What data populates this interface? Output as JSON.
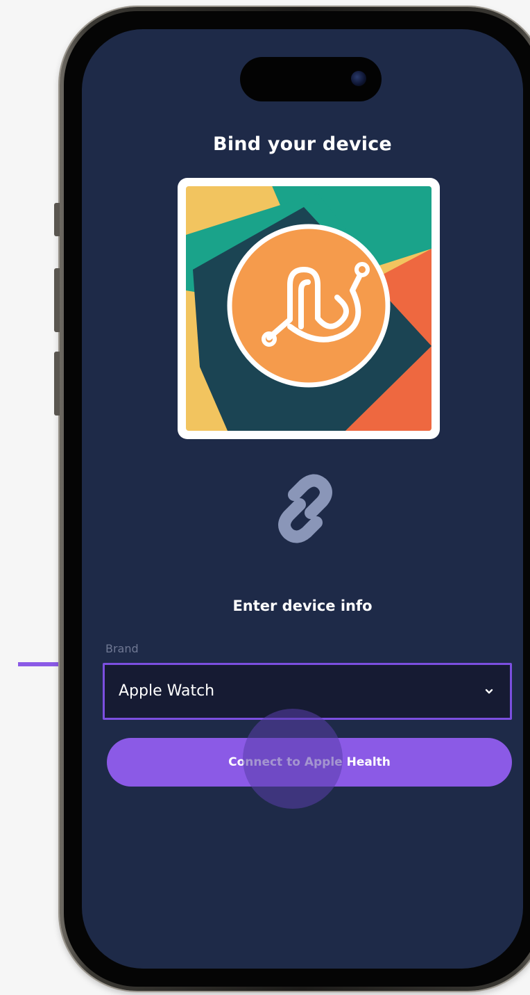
{
  "screen": {
    "title": "Bind your device",
    "section_label": "Enter device info"
  },
  "brand_field": {
    "label": "Brand",
    "selected_value": "Apple Watch"
  },
  "connect_button": {
    "label": "Connect to Apple Health"
  },
  "colors": {
    "screen_background": "#1e2a48",
    "accent": "#8b5ae6",
    "select_border": "#7b4fe0",
    "link_icon": "#8a96b8",
    "logo_orange": "#f59b4c"
  },
  "icons": [
    "app-logo-icon",
    "link-icon",
    "chevron-down-icon",
    "arrow-pointer-icon"
  ]
}
